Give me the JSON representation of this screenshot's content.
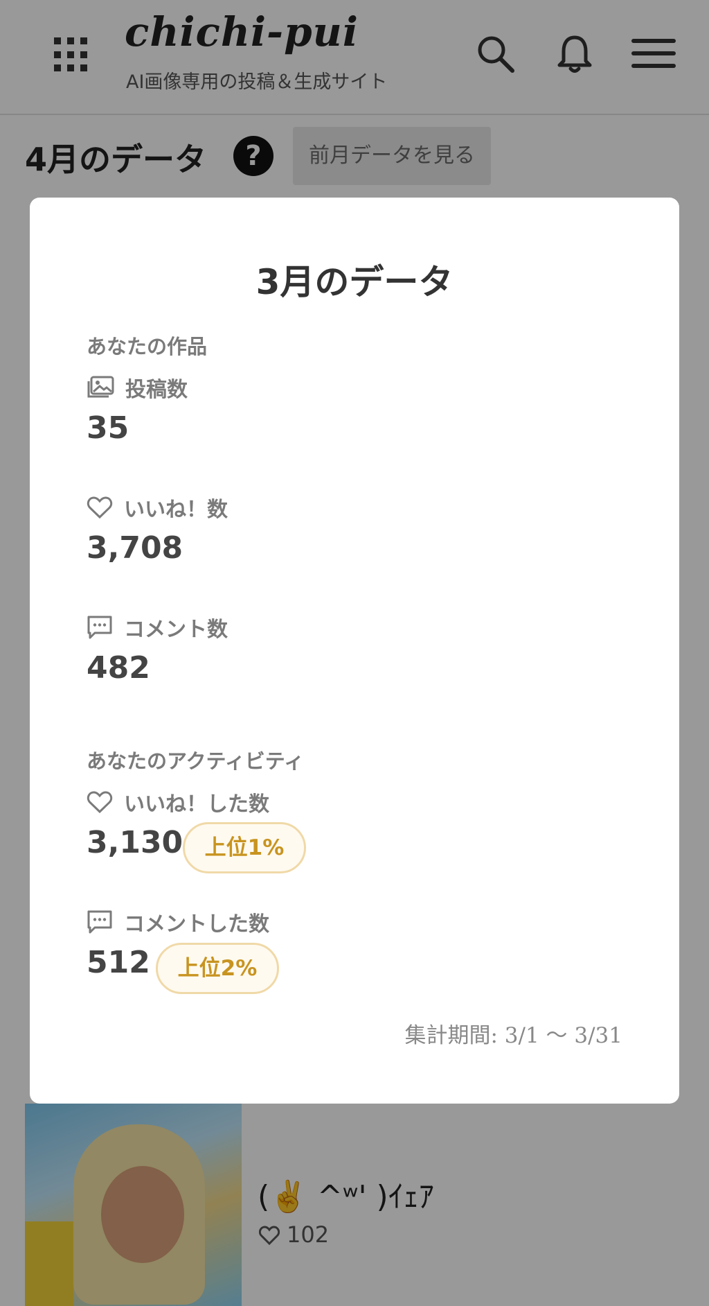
{
  "header": {
    "logo": "chichi-pui",
    "tagline": "AI画像専用の投稿＆生成サイト"
  },
  "page": {
    "title": "4月のデータ",
    "help": "?",
    "prev_button": "前月データを見る"
  },
  "card": {
    "title": "(✌️ ^ʷ' )ｲｪｱ",
    "likes": "102"
  },
  "modal": {
    "title": "3月のデータ",
    "works_section": "あなたの作品",
    "posts_label": "投稿数",
    "posts_value": "35",
    "likes_label": "いいね！数",
    "likes_value": "3,708",
    "comments_label": "コメント数",
    "comments_value": "482",
    "activity_section": "あなたのアクティビティ",
    "liked_label": "いいね！した数",
    "liked_value": "3,130",
    "liked_rank": "上位1%",
    "commented_label": "コメントした数",
    "commented_value": "512",
    "commented_rank": "上位2%",
    "period": "集計期間: 3/1 〜 3/31"
  },
  "colors": {
    "rank_text": "#c89420",
    "rank_border": "#f0d9a8",
    "overlay": "rgba(0,0,0,0.40)"
  },
  "icons": [
    "apps-grid-icon",
    "search-icon",
    "bell-icon",
    "menu-icon",
    "help-icon",
    "images-icon",
    "heart-icon",
    "comment-icon"
  ]
}
